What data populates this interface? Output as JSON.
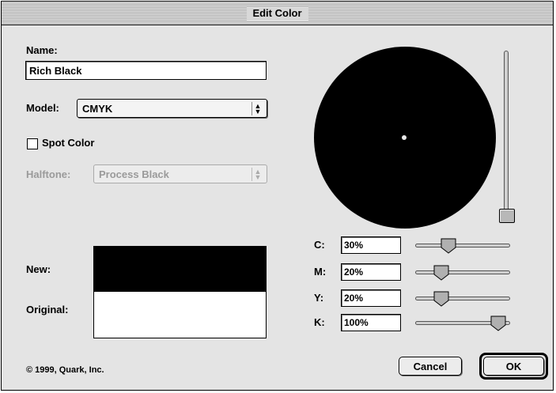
{
  "window": {
    "title": "Edit Color"
  },
  "name": {
    "label": "Name:",
    "value": "Rich Black"
  },
  "model": {
    "label": "Model:",
    "value": "CMYK"
  },
  "spot_color": {
    "label": "Spot Color",
    "checked": false
  },
  "halftone": {
    "label": "Halftone:",
    "value": "Process Black",
    "enabled": false
  },
  "preview": {
    "new_label": "New:",
    "original_label": "Original:",
    "new_color": "#000000",
    "original_color": "#ffffff"
  },
  "wheel": {
    "color": "#000000",
    "brightness_slider": 0.0
  },
  "channels": [
    {
      "key": "c",
      "label": "C:",
      "value": "30%",
      "level": 0.3
    },
    {
      "key": "m",
      "label": "M:",
      "value": "20%",
      "level": 0.2
    },
    {
      "key": "y",
      "label": "Y:",
      "value": "20%",
      "level": 0.2
    },
    {
      "key": "k",
      "label": "K:",
      "value": "100%",
      "level": 1.0
    }
  ],
  "buttons": {
    "cancel": "Cancel",
    "ok": "OK"
  },
  "footer": {
    "copyright": "© 1999, Quark, Inc."
  }
}
